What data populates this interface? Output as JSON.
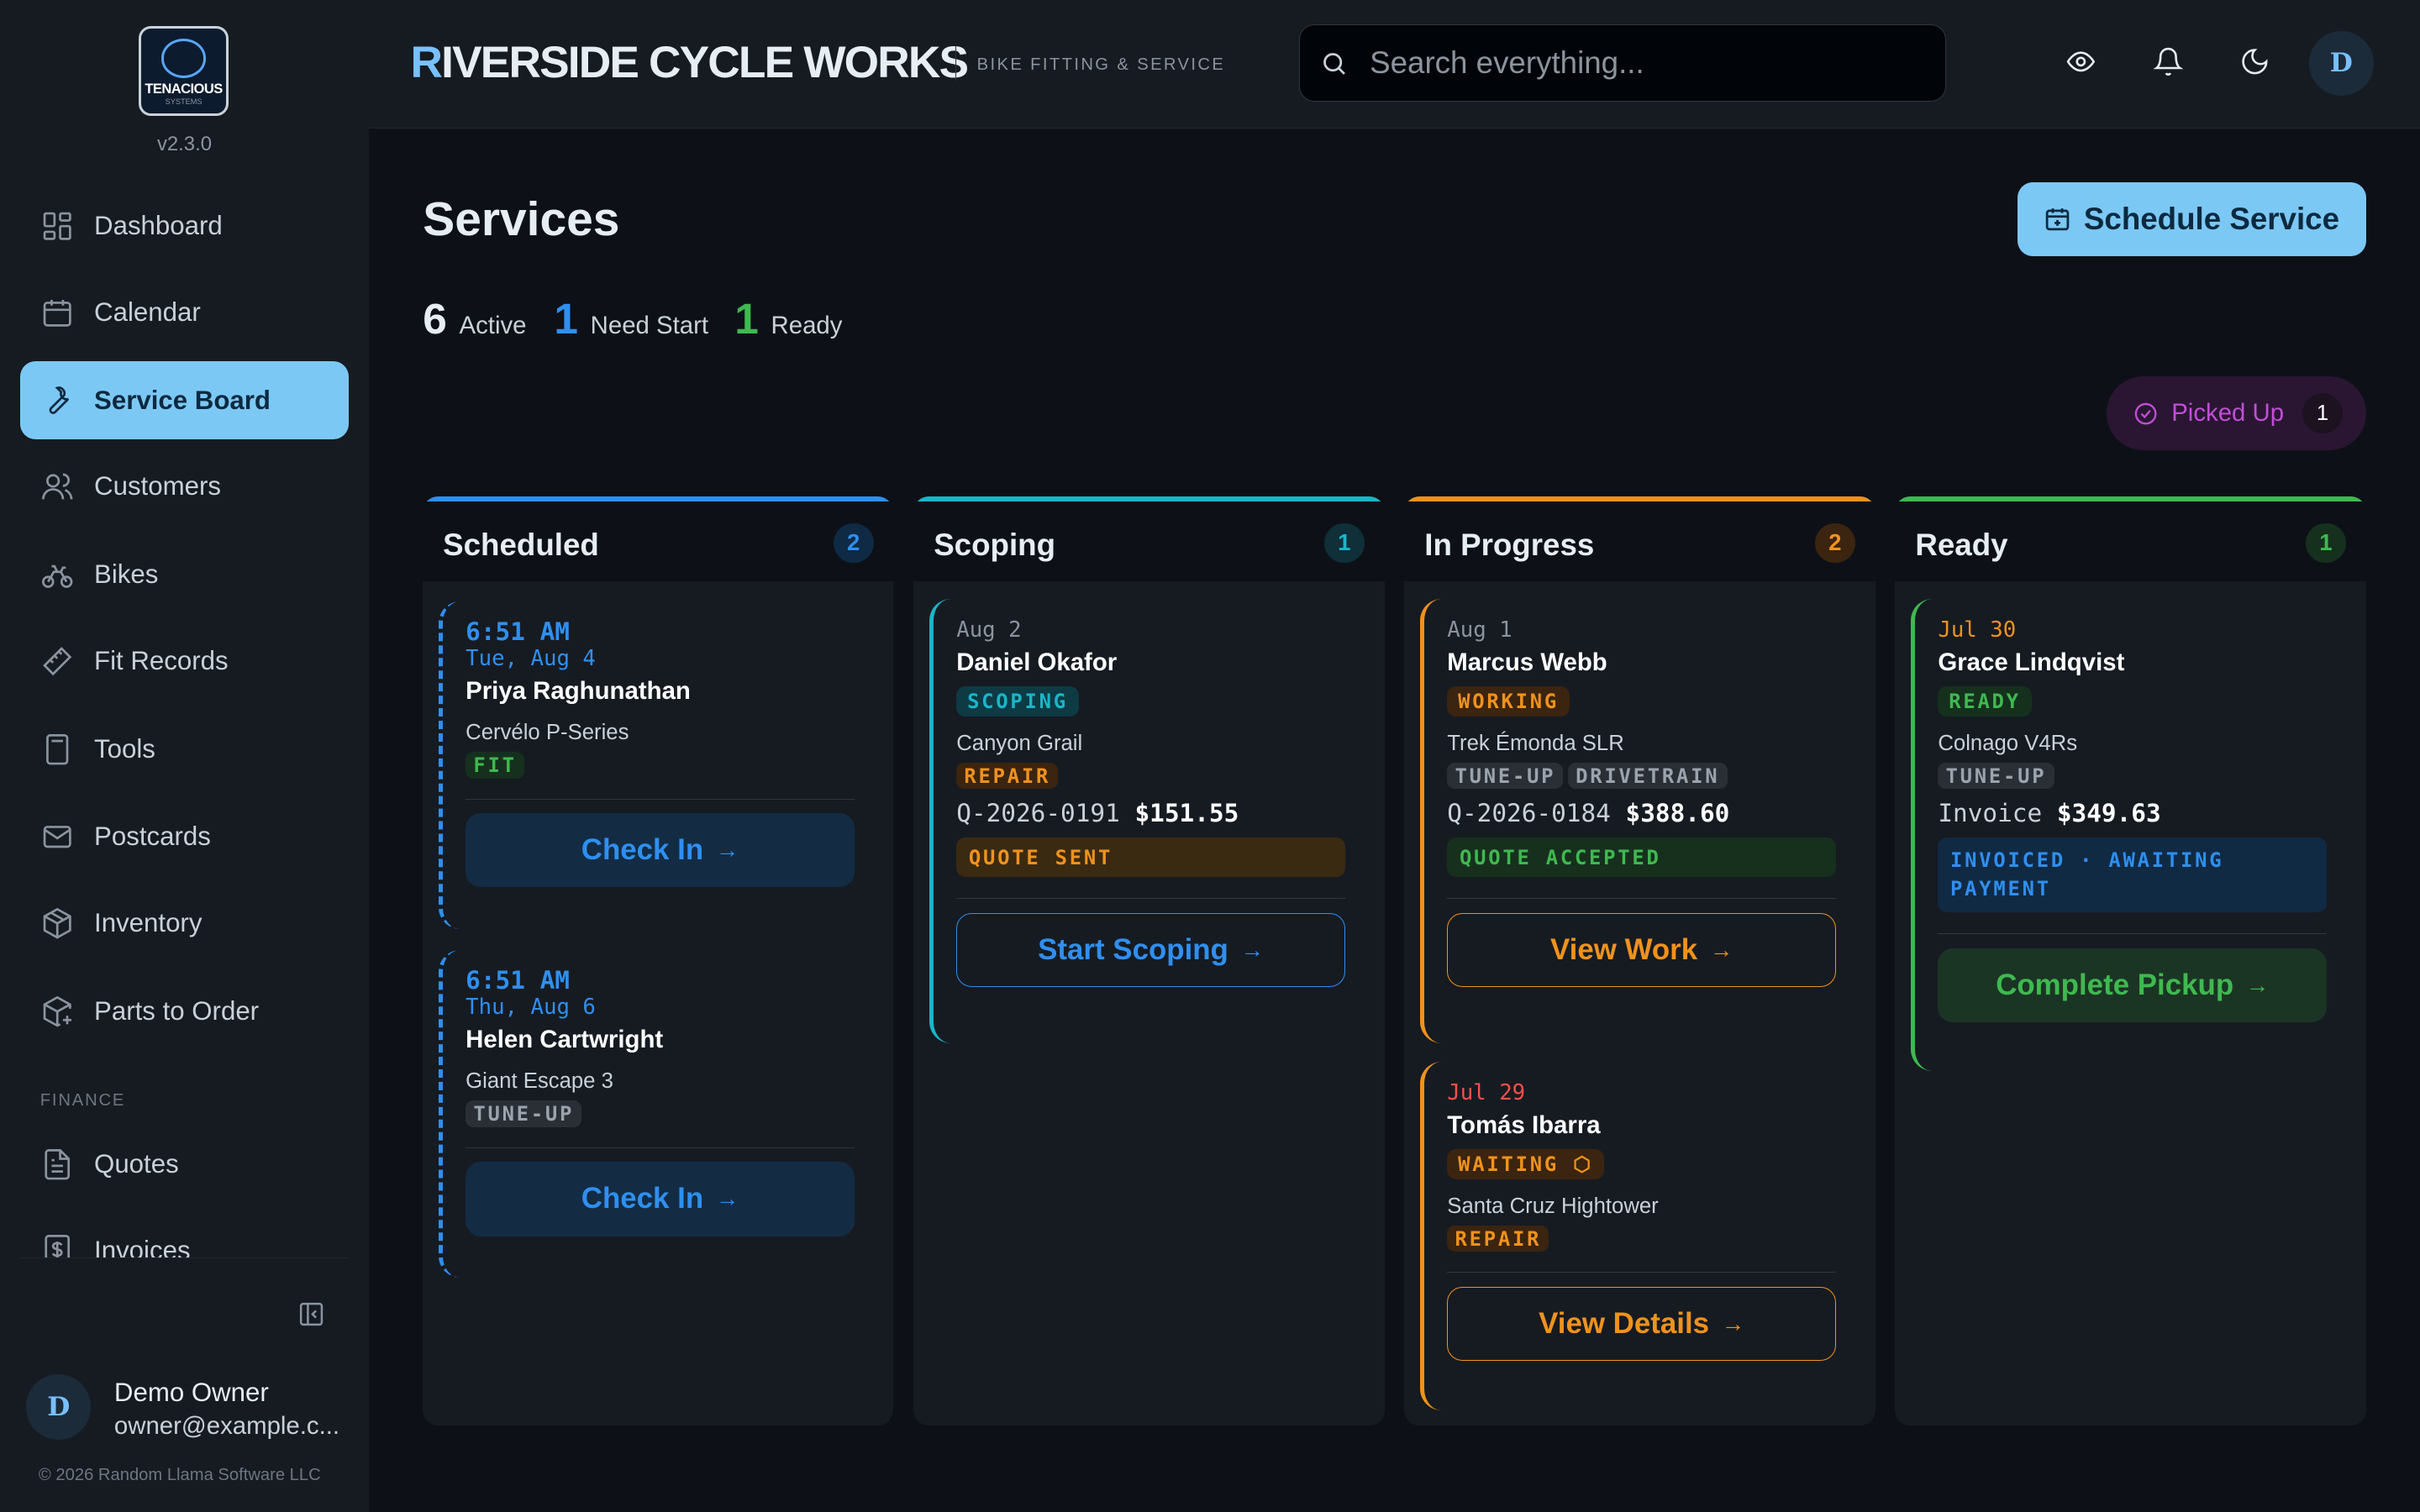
{
  "app": {
    "version": "v2.3.0",
    "logo_text": "TENACIOUS",
    "logo_subtext": "SYSTEMS",
    "brand_first": "R",
    "brand_rest": "IVERSIDE CYCLE WORKS",
    "tagline": "BIKE FITTING & SERVICE",
    "copyright": "© 2026 Random Llama Software LLC"
  },
  "sidebar": {
    "items": [
      {
        "label": "Dashboard",
        "icon": "dashboard-icon"
      },
      {
        "label": "Calendar",
        "icon": "calendar-icon"
      },
      {
        "label": "Service Board",
        "icon": "wrench-icon",
        "active": true
      },
      {
        "label": "Customers",
        "icon": "users-icon"
      },
      {
        "label": "Bikes",
        "icon": "bike-icon"
      },
      {
        "label": "Fit Records",
        "icon": "ruler-icon"
      },
      {
        "label": "Tools",
        "icon": "calculator-icon"
      },
      {
        "label": "Postcards",
        "icon": "mail-icon"
      },
      {
        "label": "Inventory",
        "icon": "box-icon"
      },
      {
        "label": "Parts to Order",
        "icon": "box-plus-icon"
      }
    ],
    "finance_section": "FINANCE",
    "finance_items": [
      {
        "label": "Quotes",
        "icon": "document-icon"
      },
      {
        "label": "Invoices",
        "icon": "invoice-icon"
      }
    ],
    "user": {
      "initial": "D",
      "name": "Demo Owner",
      "email": "owner@example.c..."
    }
  },
  "topbar": {
    "search_placeholder": "Search everything...",
    "avatar_initial": "D"
  },
  "page": {
    "title": "Services",
    "stats": [
      {
        "count": "6",
        "label": "Active",
        "color": "#e6edf3"
      },
      {
        "count": "1",
        "label": "Need Start",
        "color": "#2f8ff0"
      },
      {
        "count": "1",
        "label": "Ready",
        "color": "#3fb950"
      }
    ],
    "schedule_button": "Schedule Service",
    "picked_up_label": "Picked Up",
    "picked_up_count": "1"
  },
  "columns": [
    {
      "title": "Scheduled",
      "count": "2",
      "color": "#2f8ff0",
      "cards": [
        {
          "time": "6:51 AM",
          "date": "Tue, Aug 4",
          "name": "Priya Raghunathan",
          "bike": "Cervélo P-Series",
          "tag": "FIT",
          "button": "Check In"
        },
        {
          "time": "6:51 AM",
          "date": "Thu, Aug 6",
          "name": "Helen Cartwright",
          "bike": "Giant Escape 3",
          "tag": "TUNE-UP",
          "button": "Check In"
        }
      ]
    },
    {
      "title": "Scoping",
      "count": "1",
      "color": "#1ab6c9",
      "cards": [
        {
          "date": "Aug 2",
          "name": "Daniel Okafor",
          "status": "SCOPING",
          "bike": "Canyon Grail",
          "tags": [
            "REPAIR"
          ],
          "quote_id": "Q-2026-0191",
          "amount": "$151.55",
          "strip": "QUOTE SENT",
          "button": "Start Scoping"
        }
      ]
    },
    {
      "title": "In Progress",
      "count": "2",
      "color": "#f0921c",
      "cards": [
        {
          "date": "Aug 1",
          "name": "Marcus Webb",
          "status": "WORKING",
          "bike": "Trek Émonda SLR",
          "tags": [
            "TUNE-UP",
            "DRIVETRAIN"
          ],
          "quote_id": "Q-2026-0184",
          "amount": "$388.60",
          "strip": "QUOTE ACCEPTED",
          "button": "View Work"
        },
        {
          "date": "Jul 29",
          "name": "Tomás Ibarra",
          "status": "WAITING",
          "bike": "Santa Cruz Hightower",
          "tags": [
            "REPAIR"
          ],
          "button": "View Details"
        }
      ]
    },
    {
      "title": "Ready",
      "count": "1",
      "color": "#3fb950",
      "cards": [
        {
          "date": "Jul 30",
          "name": "Grace Lindqvist",
          "status": "READY",
          "bike": "Colnago V4Rs",
          "tags": [
            "TUNE-UP"
          ],
          "quote_id": "Invoice",
          "amount": "$349.63",
          "strip": "INVOICED · AWAITING PAYMENT",
          "button": "Complete Pickup"
        }
      ]
    }
  ]
}
